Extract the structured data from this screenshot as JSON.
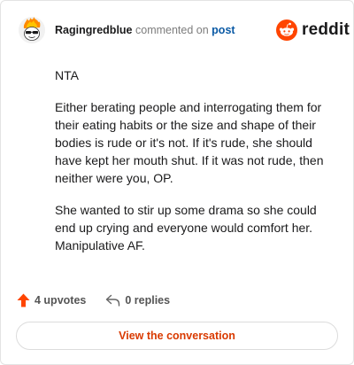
{
  "header": {
    "username": "Ragingredblue",
    "action": "commented on",
    "post_link": "post",
    "brand": "reddit"
  },
  "comment": {
    "paragraphs": [
      "NTA",
      "Either berating people and interrogating them for their eating habits or the size and shape of their bodies is rude or it's not. If it's rude, she should have kept her mouth shut. If it was not rude, then neither were you, OP.",
      "She wanted to stir up some drama so she could end up crying and everyone would comfort her. Manipulative AF."
    ]
  },
  "stats": {
    "upvotes": "4 upvotes",
    "replies": "0 replies"
  },
  "cta_label": "View the conversation",
  "colors": {
    "brand_orange": "#ff4500",
    "upvote": "#ff4500",
    "link": "#0b5aa5",
    "cta_text": "#d93a00"
  },
  "icons": {
    "avatar": "snoo-avatar-on-fire",
    "logo": "reddit-snoo-icon",
    "upvote": "upvote-arrow-icon",
    "reply": "reply-arrow-icon"
  }
}
